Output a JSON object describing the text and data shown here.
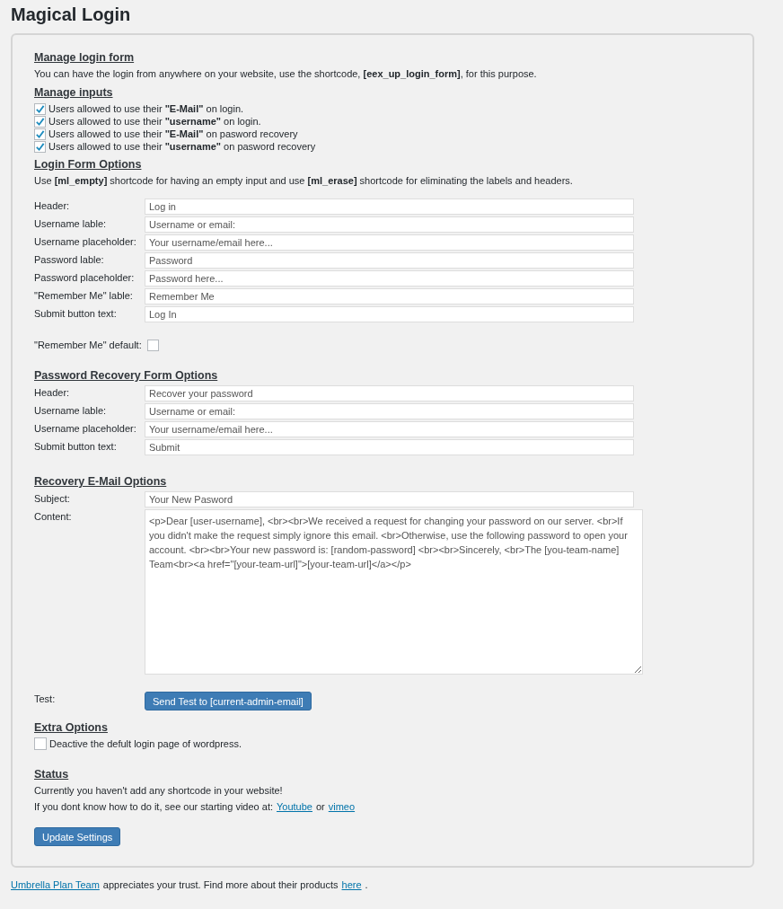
{
  "title": "Magical Login",
  "manage_form": {
    "heading": "Manage login form",
    "text": "You can have the login from anywhere on your website, use the shortcode, **[eex_up_login_form]**, for this purpose."
  },
  "manage_inputs": {
    "heading": "Manage inputs",
    "options": [
      {
        "label": "Users allowed to use their **\"E-Mail\"** on login.",
        "checked": true
      },
      {
        "label": "Users allowed to use their **\"username\"** on login.",
        "checked": true
      },
      {
        "label": "Users allowed to use their **\"E-Mail\"** on pasword recovery",
        "checked": true
      },
      {
        "label": "Users allowed to use their **\"username\"** on pasword recovery",
        "checked": true
      }
    ]
  },
  "login_form": {
    "heading": "Login Form Options",
    "note": "Use **[ml_empty]** shortcode for having an empty input and use **[ml_erase]** shortcode for eliminating the labels and headers.",
    "fields": [
      {
        "label": "Header:",
        "value": "Log in"
      },
      {
        "label": "Username lable:",
        "value": "Username or email:"
      },
      {
        "label": "Username placeholder:",
        "value": "Your username/email here..."
      },
      {
        "label": "Password lable:",
        "value": "Password"
      },
      {
        "label": "Password placeholder:",
        "value": "Password here..."
      },
      {
        "label": "\"Remember Me\" lable:",
        "value": "Remember Me"
      },
      {
        "label": "Submit button text:",
        "value": "Log In"
      }
    ],
    "remember_default": {
      "label": "\"Remember Me\" default:",
      "checked": false
    }
  },
  "recovery_form": {
    "heading": "Password Recovery Form Options",
    "fields": [
      {
        "label": "Header:",
        "value": "Recover your password"
      },
      {
        "label": "Username lable:",
        "value": "Username or email:"
      },
      {
        "label": "Username placeholder:",
        "value": "Your username/email here..."
      },
      {
        "label": "Submit button text:",
        "value": "Submit"
      }
    ]
  },
  "email_options": {
    "heading": "Recovery E-Mail Options",
    "subject": {
      "label": "Subject:",
      "value": "Your New Pasword"
    },
    "content": {
      "label": "Content:",
      "value": "<p>Dear [user-username], <br><br>We received a request for changing your password on our server. <br>If you didn't make the request simply ignore this email. <br>Otherwise, use the following password to open your account. <br><br>Your new password is: [random-password] <br><br>Sincerely, <br>The [you-team-name] Team<br><a href=\"[your-team-url]\">[your-team-url]</a></p>"
    },
    "test": {
      "label": "Test:",
      "button": "Send Test to [current-admin-email]"
    }
  },
  "extra_options": {
    "heading": "Extra Options",
    "options": [
      {
        "label": "Deactive the defult login page of wordpress.",
        "checked": false
      }
    ]
  },
  "status": {
    "heading": "Status",
    "line_1": "Currently you haven't add any shortcode in your website!",
    "line_2": "If you dont know how to do it, see our starting video at:",
    "link_1": "Youtube",
    "joiner": "or",
    "link_2": "vimeo"
  },
  "update_button": "Update Settings",
  "footer": {
    "link": "Umbrella Plan Team",
    "text": "appreciates your trust. Find more about their products",
    "link_2": "here",
    "end": "."
  }
}
